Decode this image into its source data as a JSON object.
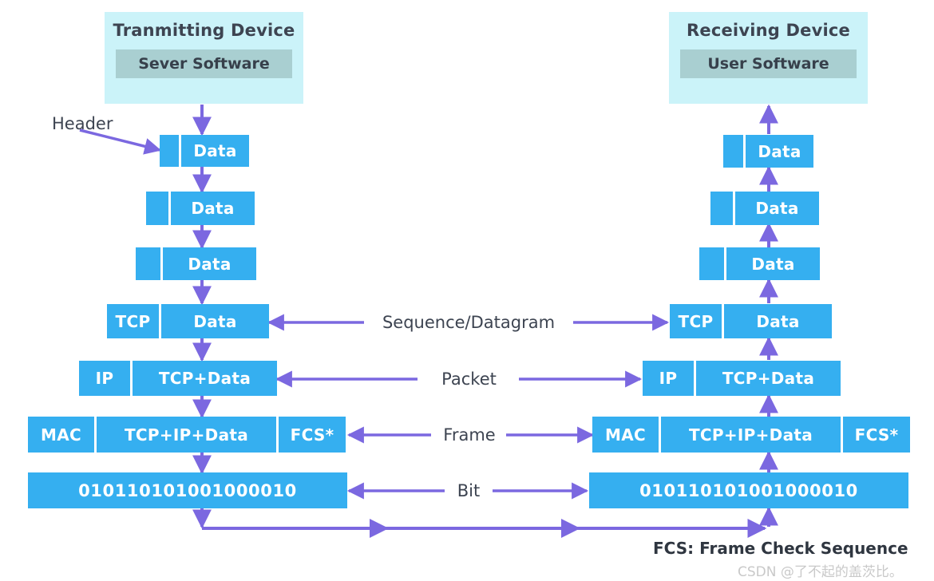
{
  "diagram": {
    "title_left": "Tranmitting Device",
    "title_right": "Receiving Device",
    "software_left": "Sever Software",
    "software_right": "User Software",
    "header_annotation": "Header",
    "footnote": "FCS: Frame Check Sequence",
    "watermark": "CSDN @了不起的盖茨比。",
    "colors": {
      "block_blue": "#35AFF0",
      "device_box": "#CBF3F9",
      "software_band": "#A9CFD1",
      "arrow_purple": "#7B68E0",
      "text_dark": "#3d4451",
      "block_text": "#ffffff"
    }
  },
  "center_labels": [
    {
      "text": "Sequence/Datagram"
    },
    {
      "text": "Packet"
    },
    {
      "text": "Frame"
    },
    {
      "text": "Bit"
    }
  ],
  "left_stack": [
    {
      "layer": "application-1",
      "cells": [
        {
          "text": ""
        },
        {
          "text": "Data"
        }
      ]
    },
    {
      "layer": "application-2",
      "cells": [
        {
          "text": ""
        },
        {
          "text": "Data"
        }
      ]
    },
    {
      "layer": "application-3",
      "cells": [
        {
          "text": ""
        },
        {
          "text": "Data"
        }
      ]
    },
    {
      "layer": "transport",
      "cells": [
        {
          "text": "TCP"
        },
        {
          "text": "Data"
        }
      ]
    },
    {
      "layer": "network",
      "cells": [
        {
          "text": "IP"
        },
        {
          "text": "TCP+Data"
        }
      ]
    },
    {
      "layer": "datalink",
      "cells": [
        {
          "text": "MAC"
        },
        {
          "text": "TCP+IP+Data"
        },
        {
          "text": "FCS*"
        }
      ]
    },
    {
      "layer": "physical",
      "cells": [
        {
          "text": "010110101001000010"
        }
      ]
    }
  ],
  "right_stack": [
    {
      "layer": "application-1",
      "cells": [
        {
          "text": ""
        },
        {
          "text": "Data"
        }
      ]
    },
    {
      "layer": "application-2",
      "cells": [
        {
          "text": ""
        },
        {
          "text": "Data"
        }
      ]
    },
    {
      "layer": "application-3",
      "cells": [
        {
          "text": ""
        },
        {
          "text": "Data"
        }
      ]
    },
    {
      "layer": "transport",
      "cells": [
        {
          "text": "TCP"
        },
        {
          "text": "Data"
        }
      ]
    },
    {
      "layer": "network",
      "cells": [
        {
          "text": "IP"
        },
        {
          "text": "TCP+Data"
        }
      ]
    },
    {
      "layer": "datalink",
      "cells": [
        {
          "text": "MAC"
        },
        {
          "text": "TCP+IP+Data"
        },
        {
          "text": "FCS*"
        }
      ]
    },
    {
      "layer": "physical",
      "cells": [
        {
          "text": "010110101001000010"
        }
      ]
    }
  ]
}
